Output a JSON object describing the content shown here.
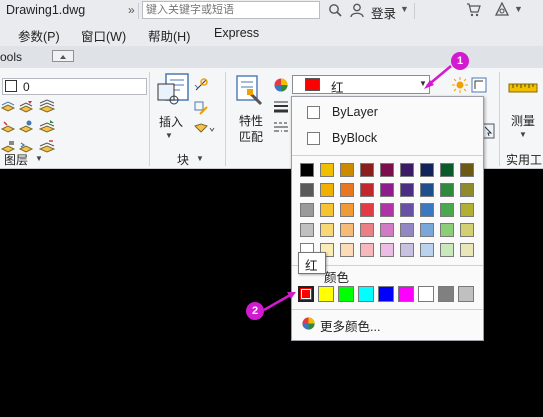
{
  "window": {
    "title": "Drawing1.dwg"
  },
  "search": {
    "placeholder": "键入关键字或短语"
  },
  "account": {
    "login_label": "登录"
  },
  "menu": {
    "items": [
      "参数(P)",
      "窗口(W)",
      "帮助(H)",
      "Express"
    ]
  },
  "tabs": {
    "partial_label": "ools"
  },
  "ribbon": {
    "layer_value": "0",
    "layer_panel_title": "图层",
    "block_panel_title": "块",
    "insert_label": "插入",
    "match_label_line1": "特性",
    "match_label_line2": "匹配",
    "measure_label": "测量",
    "utilities_panel_title": "实用工"
  },
  "color_combo": {
    "value": "红",
    "swatch_color": "#ff0000"
  },
  "color_dropdown": {
    "bylayer_label": "ByLayer",
    "byblock_label": "ByBlock",
    "standard_colors_label": "颜色",
    "more_colors_label": "更多颜色...",
    "tooltip": "红",
    "palette": [
      [
        "#000000",
        "#f0c000",
        "#cc8a00",
        "#8c1e1e",
        "#7d0e4e",
        "#3b1a66",
        "#14225c",
        "#0b5a2a",
        "#6b5a12"
      ],
      [
        "#595959",
        "#f0b000",
        "#e87722",
        "#c1272d",
        "#8e1c8c",
        "#4b2e83",
        "#1f4e8c",
        "#2e8b3e",
        "#8f8a2a"
      ],
      [
        "#9a9a9a",
        "#f5c430",
        "#f19b37",
        "#e23b44",
        "#b034a8",
        "#6751a6",
        "#3a78c4",
        "#4aa84e",
        "#b2b032"
      ],
      [
        "#c0c0c0",
        "#f7d874",
        "#f6bb76",
        "#ec7f86",
        "#d37ac6",
        "#9286c4",
        "#7aa7da",
        "#8ccd7a",
        "#d2d070"
      ],
      [
        "#ffffff",
        "#fbecb6",
        "#fcdcb7",
        "#f6b8bd",
        "#ebbde4",
        "#c8c1e2",
        "#b9d3ef",
        "#c9e8bb",
        "#e9e7b8"
      ]
    ],
    "standard_colors": [
      "#ff0000",
      "#ffff00",
      "#00ff00",
      "#00ffff",
      "#0000ff",
      "#ff00ff",
      "#ffffff",
      "#808080",
      "#c0c0c0"
    ]
  },
  "annotations": {
    "callout_1": "1",
    "callout_2": "2",
    "accent": "#d21ad0"
  }
}
